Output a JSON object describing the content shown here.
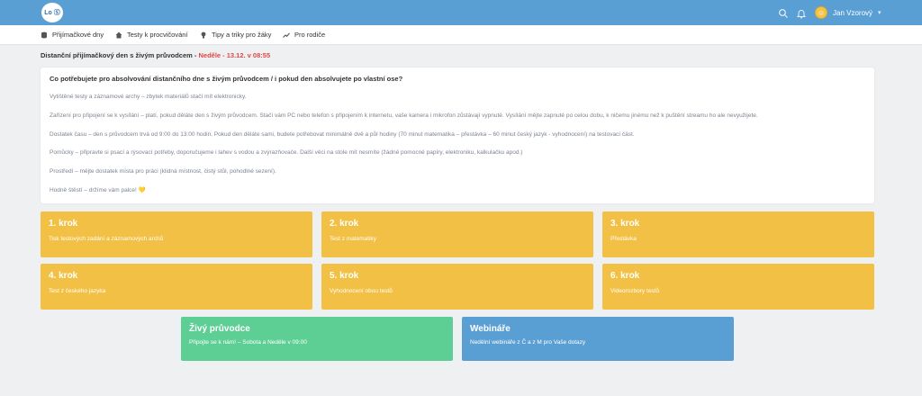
{
  "colors": {
    "topbar": "#5a9fd4",
    "step": "#f2c044",
    "live": "#5dcf94",
    "webinar": "#5a9fd4",
    "date": "#e04848"
  },
  "header": {
    "logo_text": "Lo Ⓢ",
    "user_name": "Jan Vzorový",
    "icons": [
      "search-icon",
      "bell-icon",
      "avatar",
      "chevron-down-icon"
    ]
  },
  "nav": {
    "items": [
      {
        "label": "Přijímačkové dny",
        "icon": "database-icon"
      },
      {
        "label": "Testy k procvičování",
        "icon": "home-icon"
      },
      {
        "label": "Tipy a triky pro žáky",
        "icon": "bulb-icon"
      },
      {
        "label": "Pro rodiče",
        "icon": "chart-icon"
      }
    ]
  },
  "page": {
    "title": "Distanční přijímačkový den s živým průvodcem - ",
    "date": "Neděle - 13.12. v 08:55"
  },
  "info": {
    "heading": "Co potřebujete pro absolvování distančního dne s živým průvodcem / i pokud den absolvujete po vlastní ose?",
    "paragraphs": [
      "Vytištěné testy a záznamové archy – zbytek materiálů stačí mít elektronicky.",
      "Zařízení pro připojení se k vysílání – platí, pokud děláte den s živým průvodcem. Stačí vám PC nebo telefon s připojením k internetu, vaše kamera i mikrofon zůstávají vypnuté. Vysílání mějte zapnuté po celou dobu, k ničemu jinému než k puštění streamu ho ale nevyužijete.",
      "Dostatek času – den s průvodcem trvá od 9:00 do 13:00 hodin. Pokud den děláte sami, budete potřebovat minimálně dvě a půl hodiny (70 minut matematika – přestávka – 60 minut český jazyk - vyhodnocení) na testovací část.",
      "Pomůcky – připravte si psací a rýsovací potřeby, doporučujeme i lahev s vodou a zvýrazňovače. Další věci na stole mít nesmíte (žádné pomocné papíry, elektroniku, kalkulačku apod.)",
      "Prostředí – mějte dostatek místa pro práci (klidná místnost, čistý stůl, pohodlné sezení).",
      "Hodně štěstí – držíme vám palce! "
    ],
    "heart": "💛"
  },
  "steps": [
    {
      "title": "1. krok",
      "subtitle": "Tisk testových zadání a záznamových archů"
    },
    {
      "title": "2. krok",
      "subtitle": "Test z matematiky"
    },
    {
      "title": "3. krok",
      "subtitle": "Přestávka"
    },
    {
      "title": "4. krok",
      "subtitle": "Test z českého jazyka"
    },
    {
      "title": "5. krok",
      "subtitle": "Vyhodnocení obou testů"
    },
    {
      "title": "6. krok",
      "subtitle": "Videorozbory testů"
    }
  ],
  "live": {
    "title": "Živý průvodce",
    "subtitle": "Připojte se k nám! – Sobota a Neděle v 09:00"
  },
  "webinar": {
    "title": "Webináře",
    "subtitle": "Nedělní webináře z Č a z M pro Vaše dotazy"
  }
}
